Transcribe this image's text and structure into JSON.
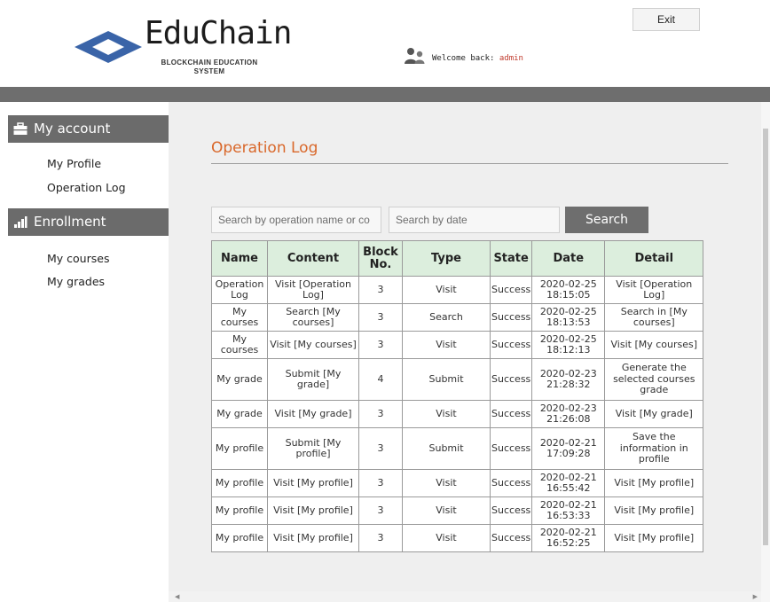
{
  "header": {
    "exit_label": "Exit",
    "brand_title": "EduChain",
    "brand_subtitle_line1": "BLOCKCHAIN EDUCATION",
    "brand_subtitle_line2": "SYSTEM",
    "welcome_prefix": "Welcome back: ",
    "username": "admin"
  },
  "sidebar": {
    "sections": [
      {
        "label": "My account",
        "icon": "briefcase-icon",
        "items": [
          "My Profile",
          "Operation Log"
        ]
      },
      {
        "label": "Enrollment",
        "icon": "bar-chart-icon",
        "items": [
          "My courses",
          "My grades"
        ]
      }
    ]
  },
  "main": {
    "title": "Operation Log",
    "search": {
      "name_placeholder": "Search by operation name or co",
      "date_placeholder": "Search by date",
      "button_label": "Search"
    },
    "table": {
      "headers": [
        "Name",
        "Content",
        "Block No.",
        "Type",
        "State",
        "Date",
        "Detail"
      ],
      "rows": [
        [
          "Operation Log",
          "Visit [Operation Log]",
          "3",
          "Visit",
          "Success",
          "2020-02-25 18:15:05",
          "Visit [Operation Log]"
        ],
        [
          "My courses",
          "Search [My courses]",
          "3",
          "Search",
          "Success",
          "2020-02-25 18:13:53",
          "Search in [My courses]"
        ],
        [
          "My courses",
          "Visit [My courses]",
          "3",
          "Visit",
          "Success",
          "2020-02-25 18:12:13",
          "Visit [My courses]"
        ],
        [
          "My grade",
          "Submit [My grade]",
          "4",
          "Submit",
          "Success",
          "2020-02-23 21:28:32",
          "Generate the selected courses grade"
        ],
        [
          "My grade",
          "Visit [My grade]",
          "3",
          "Visit",
          "Success",
          "2020-02-23 21:26:08",
          "Visit [My grade]"
        ],
        [
          "My profile",
          "Submit [My profile]",
          "3",
          "Submit",
          "Success",
          "2020-02-21 17:09:28",
          "Save the information in profile"
        ],
        [
          "My profile",
          "Visit [My profile]",
          "3",
          "Visit",
          "Success",
          "2020-02-21 16:55:42",
          "Visit [My profile]"
        ],
        [
          "My profile",
          "Visit [My profile]",
          "3",
          "Visit",
          "Success",
          "2020-02-21 16:53:33",
          "Visit [My profile]"
        ],
        [
          "My profile",
          "Visit [My profile]",
          "3",
          "Visit",
          "Success",
          "2020-02-21 16:52:25",
          "Visit [My profile]"
        ]
      ]
    }
  },
  "colors": {
    "accent": "#d9682b",
    "header_bg": "#dceedd",
    "sidebar_section_bg": "#6b6b6b",
    "logo_blue": "#3a64a8",
    "username_red": "#c0392b"
  }
}
